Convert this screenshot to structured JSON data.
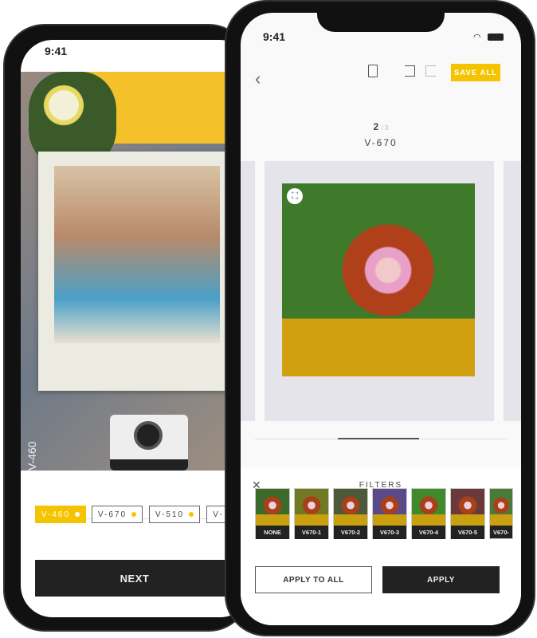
{
  "left_phone": {
    "status_time": "9:41",
    "film_chips": [
      {
        "label": "V-460",
        "selected": true
      },
      {
        "label": "V-670",
        "selected": false
      },
      {
        "label": "V-510",
        "selected": false
      },
      {
        "label": "V-",
        "selected": false
      }
    ],
    "next_label": "NEXT",
    "frame_caption": "V-460"
  },
  "right_phone": {
    "status_time": "9:41",
    "toolbar": {
      "back_icon": "chevron-left-icon",
      "delete_icon": "trash-icon",
      "undo_icon": "undo-icon",
      "redo_icon": "redo-icon",
      "save_all_label": "SAVE ALL"
    },
    "page_index": {
      "current": "2",
      "total": "/ 3"
    },
    "film_name": "V-670",
    "filters": {
      "title": "FILTERS",
      "items": [
        {
          "label": "NONE",
          "color": "#3b6a2a"
        },
        {
          "label": "V670-1",
          "color": "#6f7a22"
        },
        {
          "label": "V670-2",
          "color": "#4c5a3a"
        },
        {
          "label": "V670-3",
          "color": "#5a4a8a"
        },
        {
          "label": "V670-4",
          "color": "#3f8a2a"
        },
        {
          "label": "V670-5",
          "color": "#6a3a3a"
        },
        {
          "label": "V670-",
          "color": "#4a7a3a"
        }
      ],
      "apply_all_label": "APPLY TO ALL",
      "apply_label": "APPLY"
    }
  },
  "colors": {
    "accent": "#f5c400",
    "dark": "#222222"
  }
}
